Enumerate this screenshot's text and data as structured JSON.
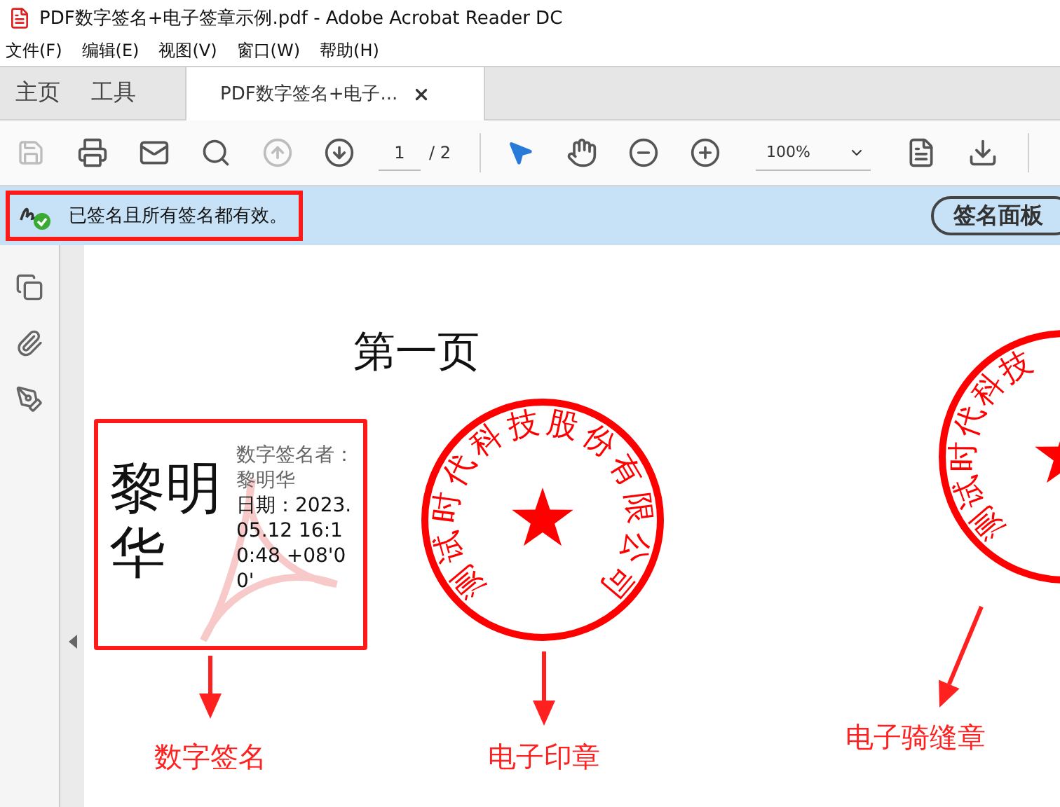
{
  "window": {
    "title": "PDF数字签名+电子签章示例.pdf - Adobe Acrobat Reader DC"
  },
  "menu": [
    "文件(F)",
    "编辑(E)",
    "视图(V)",
    "窗口(W)",
    "帮助(H)"
  ],
  "tabs": [
    {
      "label": "主页",
      "selected": false,
      "kind": "nav"
    },
    {
      "label": "工具",
      "selected": false,
      "kind": "nav"
    },
    {
      "label": "PDF数字签名+电子...",
      "selected": true,
      "kind": "document"
    }
  ],
  "toolbar": {
    "tools": [
      {
        "kind": "save",
        "disabled": true
      },
      {
        "kind": "print",
        "disabled": false
      },
      {
        "kind": "mail",
        "disabled": false
      },
      {
        "kind": "search",
        "disabled": false
      },
      {
        "kind": "up",
        "disabled": true
      },
      {
        "kind": "down",
        "disabled": false
      }
    ],
    "page": "1",
    "page_total": "/ 2",
    "nav_tools": [
      {
        "kind": "select",
        "selected": true
      },
      {
        "kind": "hand",
        "selected": false
      },
      {
        "kind": "zoom-out",
        "selected": false
      },
      {
        "kind": "zoom-in",
        "selected": false
      }
    ],
    "zoom": "100%"
  },
  "signature_bar": {
    "message": "已签名且所有签名都有效。",
    "button": "签名面板",
    "highlighted": true
  },
  "document": {
    "heading": "第一页",
    "signature": {
      "name": "黎明华",
      "signer": "数字签名者：黎明华",
      "date": "日期：2023.05.12 16:10:48 +08'00'"
    },
    "seals": [
      {
        "text": "测试时代科技股份有限公司"
      },
      {
        "text": "测试时代科技"
      }
    ],
    "annotations": [
      {
        "label": "数字签名"
      },
      {
        "label": "电子印章"
      },
      {
        "label": "电子骑缝章"
      }
    ]
  }
}
